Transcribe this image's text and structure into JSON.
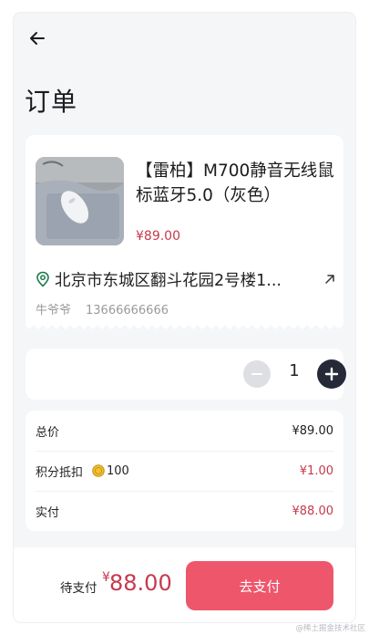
{
  "header": {
    "title": "订单",
    "back_icon": "arrow-left-icon"
  },
  "product": {
    "name": "【雷柏】M700静音无线鼠标蓝牙5.0（灰色）",
    "price": "¥89.00",
    "image_icon": "mouse-product-image"
  },
  "address": {
    "icon": "location-pin-icon",
    "text": "北京市东城区翻斗花园2号楼1...",
    "action_icon": "arrow-up-right-icon",
    "contact_name": "牛爷爷",
    "contact_phone": "13666666666"
  },
  "quantity": {
    "value": "1",
    "minus_icon": "minus-icon",
    "plus_icon": "plus-icon"
  },
  "summary": {
    "total_label": "总价",
    "total_value": "¥89.00",
    "points_label": "积分抵扣",
    "points_icon": "coin-icon",
    "points_amount": "100",
    "points_value": "¥1.00",
    "paid_label": "实付",
    "paid_value": "¥88.00"
  },
  "footer": {
    "pay_label": "待支付",
    "currency": "¥",
    "pay_amount": "88.00",
    "pay_button": "去支付"
  },
  "watermark": "@稀土掘金技术社区",
  "colors": {
    "accent_red": "#c6394d",
    "pay_button": "#ee566b",
    "plus_button": "#262a38",
    "page_bg": "#f5f6f8"
  }
}
